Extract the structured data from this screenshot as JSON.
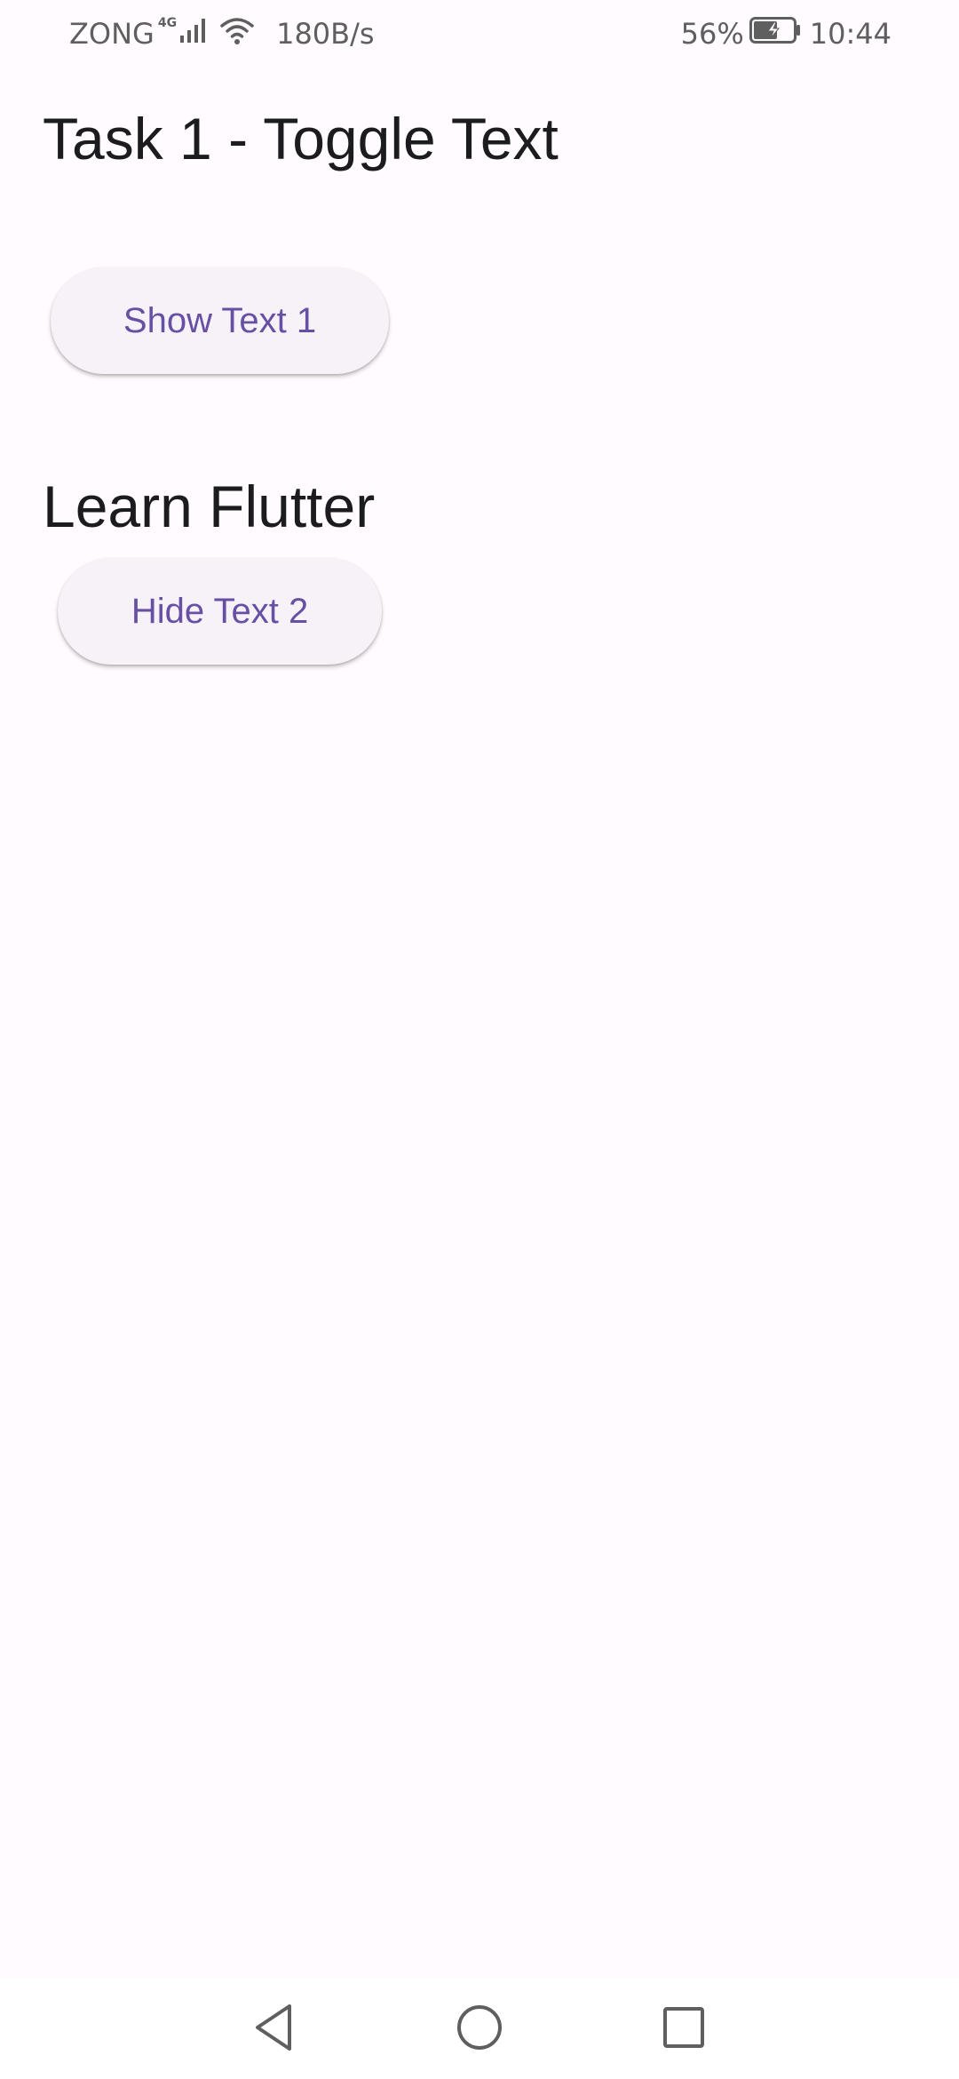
{
  "status_bar": {
    "carrier": "ZONG",
    "network_type": "4G",
    "speed": "180B/s",
    "battery": "56%",
    "time": "10:44",
    "icons": [
      "signal-icon",
      "wifi-icon",
      "battery-charging-icon"
    ]
  },
  "page": {
    "title": "Task 1 - Toggle Text",
    "show_button_label": "Show Text 1",
    "shown_text": "Learn Flutter",
    "hide_button_label": "Hide Text 2"
  },
  "nav_bar": {
    "icons": [
      "back-icon",
      "home-icon",
      "recents-icon"
    ]
  },
  "colors": {
    "background": "#fffbfe",
    "button_background": "#f6f2f8",
    "button_text": "#6750a4",
    "text_primary": "#1c1b1f",
    "status_text": "#5f5f5f"
  }
}
